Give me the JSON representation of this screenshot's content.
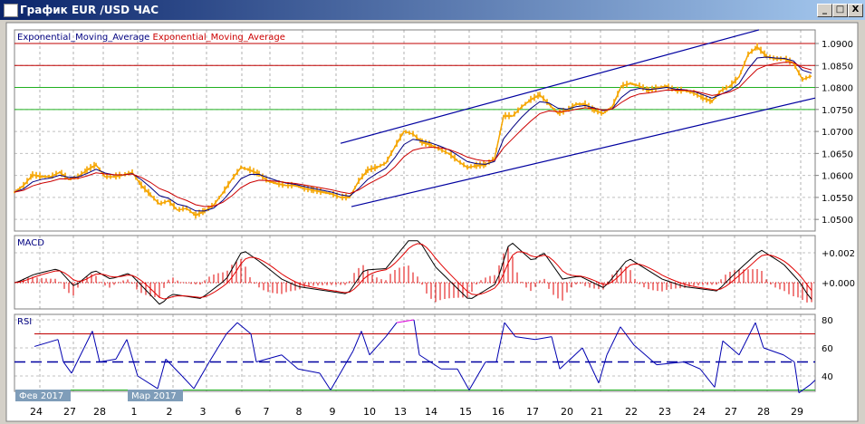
{
  "window": {
    "title": "График EUR /USD  ЧАС",
    "minimize": "_",
    "maximize": "□",
    "close": "X"
  },
  "legend": {
    "ema1": "Exponential_Moving_Average",
    "ema2": "Exponential_Moving_Average"
  },
  "colors": {
    "price": "#f5a500",
    "ema_fast": "#000080",
    "ema_slow": "#cc0000",
    "channel": "#0000a0",
    "level_red": "#c00000",
    "level_green": "#20b020",
    "macd": "#000000",
    "signal": "#e00000",
    "rsi": "#0000b0",
    "rsi_overbought": "#e000e0"
  },
  "chart_data": [
    {
      "type": "line",
      "title": "",
      "symbol": "EUR/USD",
      "timeframe": "H1",
      "ylim": [
        1.048,
        1.0925
      ],
      "y_ticks": [
        "1.0900",
        "1.0850",
        "1.0800",
        "1.0750",
        "1.0700",
        "1.0650",
        "1.0600",
        "1.0550",
        "1.0500"
      ],
      "x_ticks": [
        {
          "label": "24",
          "i": 2.4
        },
        {
          "label": "27",
          "i": 6.1
        },
        {
          "label": "28",
          "i": 9.4
        },
        {
          "label": "1",
          "i": 13.2
        },
        {
          "label": "2",
          "i": 17.1
        },
        {
          "label": "3",
          "i": 20.8
        },
        {
          "label": "6",
          "i": 24.7
        },
        {
          "label": "7",
          "i": 27.8
        },
        {
          "label": "8",
          "i": 31.4
        },
        {
          "label": "9",
          "i": 35.1
        },
        {
          "label": "10",
          "i": 39.2
        },
        {
          "label": "13",
          "i": 42.6
        },
        {
          "label": "14",
          "i": 46
        },
        {
          "label": "15",
          "i": 49.8
        },
        {
          "label": "16",
          "i": 53.4
        },
        {
          "label": "17",
          "i": 57.2
        },
        {
          "label": "20",
          "i": 61
        },
        {
          "label": "21",
          "i": 64.3
        },
        {
          "label": "22",
          "i": 68.1
        },
        {
          "label": "23",
          "i": 71.8
        },
        {
          "label": "24",
          "i": 75.6
        },
        {
          "label": "27",
          "i": 79.1
        },
        {
          "label": "28",
          "i": 82.7
        },
        {
          "label": "29",
          "i": 86.4
        }
      ],
      "months": [
        {
          "label": "Фев 2017",
          "i": 0
        },
        {
          "label": "Мар 2017",
          "i": 12.4
        }
      ],
      "close": [
        1.0562,
        1.0577,
        1.0601,
        1.0597,
        1.0597,
        1.0607,
        1.0591,
        1.0597,
        1.0612,
        1.0624,
        1.0597,
        1.0597,
        1.0601,
        1.0607,
        1.0577,
        1.0556,
        1.0535,
        1.0542,
        1.0521,
        1.0525,
        1.0509,
        1.0519,
        1.0533,
        1.056,
        1.0591,
        1.0618,
        1.0612,
        1.0603,
        1.0587,
        1.0581,
        1.0577,
        1.0577,
        1.057,
        1.0566,
        1.0562,
        1.0558,
        1.055,
        1.055,
        1.0587,
        1.0612,
        1.0618,
        1.0628,
        1.0665,
        1.07,
        1.0694,
        1.0675,
        1.0669,
        1.0659,
        1.0649,
        1.0632,
        1.0618,
        1.0622,
        1.0624,
        1.0638,
        1.0735,
        1.0735,
        1.0756,
        1.0772,
        1.0783,
        1.0762,
        1.0741,
        1.0748,
        1.0762,
        1.0762,
        1.0748,
        1.0741,
        1.0756,
        1.0803,
        1.0809,
        1.0803,
        1.0793,
        1.0799,
        1.0803,
        1.0793,
        1.0793,
        1.0787,
        1.0776,
        1.0768,
        1.0793,
        1.0803,
        1.0824,
        1.0875,
        1.0892,
        1.0871,
        1.0865,
        1.0865,
        1.0855,
        1.0818,
        1.0826
      ],
      "h_levels": [
        {
          "value": 1.09,
          "color": "red"
        },
        {
          "value": 1.085,
          "color": "red"
        },
        {
          "value": 1.08,
          "color": "green"
        },
        {
          "value": 1.075,
          "color": "green"
        }
      ],
      "channel": [
        {
          "from": [
            36,
            1.0673
          ],
          "to": [
            82.2,
            1.0931
          ]
        },
        {
          "from": [
            37.2,
            1.0529
          ],
          "to": [
            88.4,
            1.0776
          ]
        }
      ]
    },
    {
      "type": "line",
      "title": "MACD",
      "y_ticks": [
        "+0.002",
        "+0.000"
      ],
      "macd": [
        [
          0.2,
          0
        ],
        [
          2.1,
          0.00054
        ],
        [
          4.8,
          0.00094
        ],
        [
          6.6,
          -0.00026
        ],
        [
          8.8,
          0.00084
        ],
        [
          10.6,
          0.00024
        ],
        [
          12.7,
          0.00064
        ],
        [
          16.1,
          -0.0015
        ],
        [
          17.3,
          -0.00076
        ],
        [
          20.6,
          -0.00106
        ],
        [
          23.4,
          0.00024
        ],
        [
          25.2,
          0.0022
        ],
        [
          27,
          0.00144
        ],
        [
          29.5,
          0.00024
        ],
        [
          31.3,
          -0.00026
        ],
        [
          36.8,
          -0.00076
        ],
        [
          38.6,
          0.00084
        ],
        [
          41,
          0.00094
        ],
        [
          43.5,
          0.0028
        ],
        [
          44.7,
          0.0028
        ],
        [
          46.5,
          0.00104
        ],
        [
          50.2,
          -0.00116
        ],
        [
          53.2,
          -6e-05
        ],
        [
          54.7,
          0.0028
        ],
        [
          57.2,
          0.00144
        ],
        [
          58.4,
          0.00204
        ],
        [
          60.5,
          0.00024
        ],
        [
          62.4,
          0.00044
        ],
        [
          65.1,
          -0.00036
        ],
        [
          67.8,
          0.00164
        ],
        [
          71.5,
          0.00024
        ],
        [
          73.9,
          -0.00026
        ],
        [
          77.6,
          -0.00056
        ],
        [
          79.4,
          0.00054
        ],
        [
          82.4,
          0.0022
        ],
        [
          84.9,
          0.00124
        ],
        [
          86.7,
          4e-05
        ],
        [
          87.9,
          -0.00112
        ]
      ]
    },
    {
      "type": "line",
      "title": "RSI",
      "ylim": [
        25,
        82
      ],
      "y_ticks": [
        "80",
        "60",
        "40"
      ],
      "levels": [
        70,
        50,
        30
      ],
      "rsi": [
        [
          2.2,
          61
        ],
        [
          4.8,
          66
        ],
        [
          5.4,
          50
        ],
        [
          6.3,
          42
        ],
        [
          8.6,
          72
        ],
        [
          9.4,
          50
        ],
        [
          11.2,
          52
        ],
        [
          12.4,
          66
        ],
        [
          13.6,
          40
        ],
        [
          15.8,
          31
        ],
        [
          16.7,
          52
        ],
        [
          18.5,
          40
        ],
        [
          19.8,
          31
        ],
        [
          21.5,
          50
        ],
        [
          23.4,
          70
        ],
        [
          24.6,
          78
        ],
        [
          26.1,
          70
        ],
        [
          26.7,
          50
        ],
        [
          29.5,
          55
        ],
        [
          31.3,
          45
        ],
        [
          33.7,
          42
        ],
        [
          34.9,
          30
        ],
        [
          37.4,
          58
        ],
        [
          38.3,
          72
        ],
        [
          39.2,
          55
        ],
        [
          41,
          68
        ],
        [
          42.2,
          78
        ],
        [
          44.1,
          80
        ],
        [
          44.7,
          55
        ],
        [
          47.1,
          45
        ],
        [
          48.9,
          45
        ],
        [
          50.2,
          30
        ],
        [
          52,
          50
        ],
        [
          53.2,
          50
        ],
        [
          54.1,
          78
        ],
        [
          55.3,
          68
        ],
        [
          57.5,
          66
        ],
        [
          59.3,
          68
        ],
        [
          60.2,
          45
        ],
        [
          62.7,
          60
        ],
        [
          64.5,
          35
        ],
        [
          65.4,
          55
        ],
        [
          66.9,
          75
        ],
        [
          68.4,
          62
        ],
        [
          70.9,
          48
        ],
        [
          73.9,
          50
        ],
        [
          75.7,
          45
        ],
        [
          77.3,
          32
        ],
        [
          78.2,
          65
        ],
        [
          80,
          55
        ],
        [
          81.8,
          78
        ],
        [
          82.7,
          60
        ],
        [
          84.9,
          55
        ],
        [
          86.1,
          50
        ],
        [
          86.6,
          28
        ],
        [
          87.9,
          34
        ],
        [
          88.4,
          37
        ]
      ]
    }
  ]
}
